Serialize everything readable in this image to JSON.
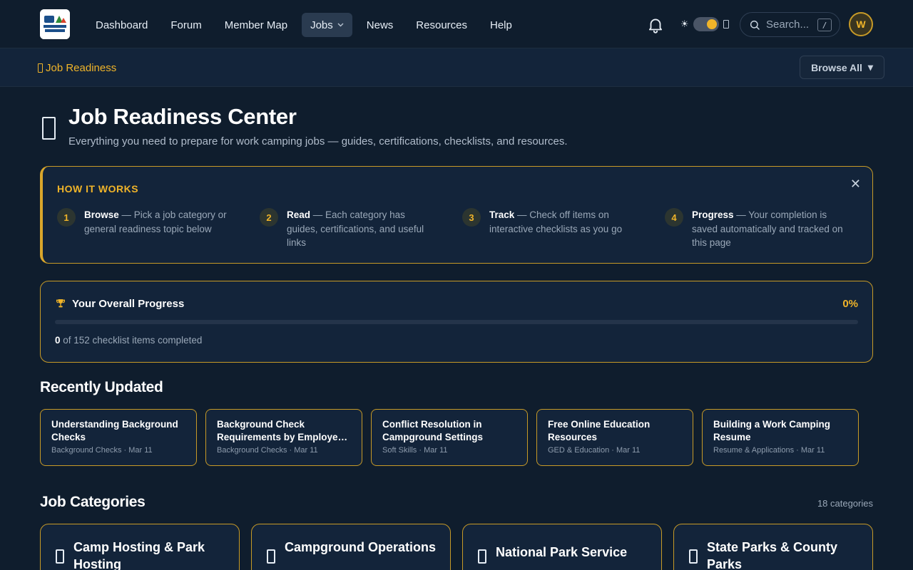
{
  "nav": {
    "links": [
      {
        "label": "Dashboard"
      },
      {
        "label": "Forum"
      },
      {
        "label": "Member Map"
      },
      {
        "label": "Jobs",
        "active": true
      },
      {
        "label": "News"
      },
      {
        "label": "Resources"
      },
      {
        "label": "Help"
      }
    ],
    "search_placeholder": "Search...",
    "search_shortcut": "/",
    "avatar_initial": "W",
    "theme_sun": "☀"
  },
  "subbar": {
    "crumb": "Job Readiness",
    "browse_label": "Browse All",
    "browse_caret": "▾"
  },
  "header": {
    "title": "Job Readiness Center",
    "subtitle": "Everything you need to prepare for work camping jobs — guides, certifications, checklists, and resources."
  },
  "how": {
    "title": "HOW IT WORKS",
    "close": "✕",
    "steps": [
      {
        "num": "1",
        "name": "Browse",
        "text": " — Pick a job category or general readiness topic below"
      },
      {
        "num": "2",
        "name": "Read",
        "text": " — Each category has guides, certifications, and useful links"
      },
      {
        "num": "3",
        "name": "Track",
        "text": " — Check off items on interactive checklists as you go"
      },
      {
        "num": "4",
        "name": "Progress",
        "text": " — Your completion is saved automatically and tracked on this page"
      }
    ]
  },
  "progress": {
    "title": "Your Overall Progress",
    "percent_label": "0%",
    "fraction": 0,
    "completed": "0",
    "rest": " of 152 checklist items completed"
  },
  "recent": {
    "title": "Recently Updated",
    "items": [
      {
        "title": "Understanding Background Checks",
        "meta": "Background Checks · Mar 11"
      },
      {
        "title": "Background Check Requirements by Employer Type",
        "meta": "Background Checks · Mar 11"
      },
      {
        "title": "Conflict Resolution in Campground Settings",
        "meta": "Soft Skills · Mar 11"
      },
      {
        "title": "Free Online Education Resources",
        "meta": "GED & Education · Mar 11"
      },
      {
        "title": "Building a Work Camping Resume",
        "meta": "Resume & Applications · Mar 11"
      }
    ]
  },
  "categories": {
    "title": "Job Categories",
    "count": "18 categories",
    "items": [
      {
        "title": "Camp Hosting & Park Hosting"
      },
      {
        "title": "Campground Operations"
      },
      {
        "title": "National Park Service"
      },
      {
        "title": "State Parks & County Parks"
      }
    ]
  },
  "colors": {
    "accent": "#f0b429",
    "background": "#0f1d2d",
    "card": "#13243a"
  }
}
